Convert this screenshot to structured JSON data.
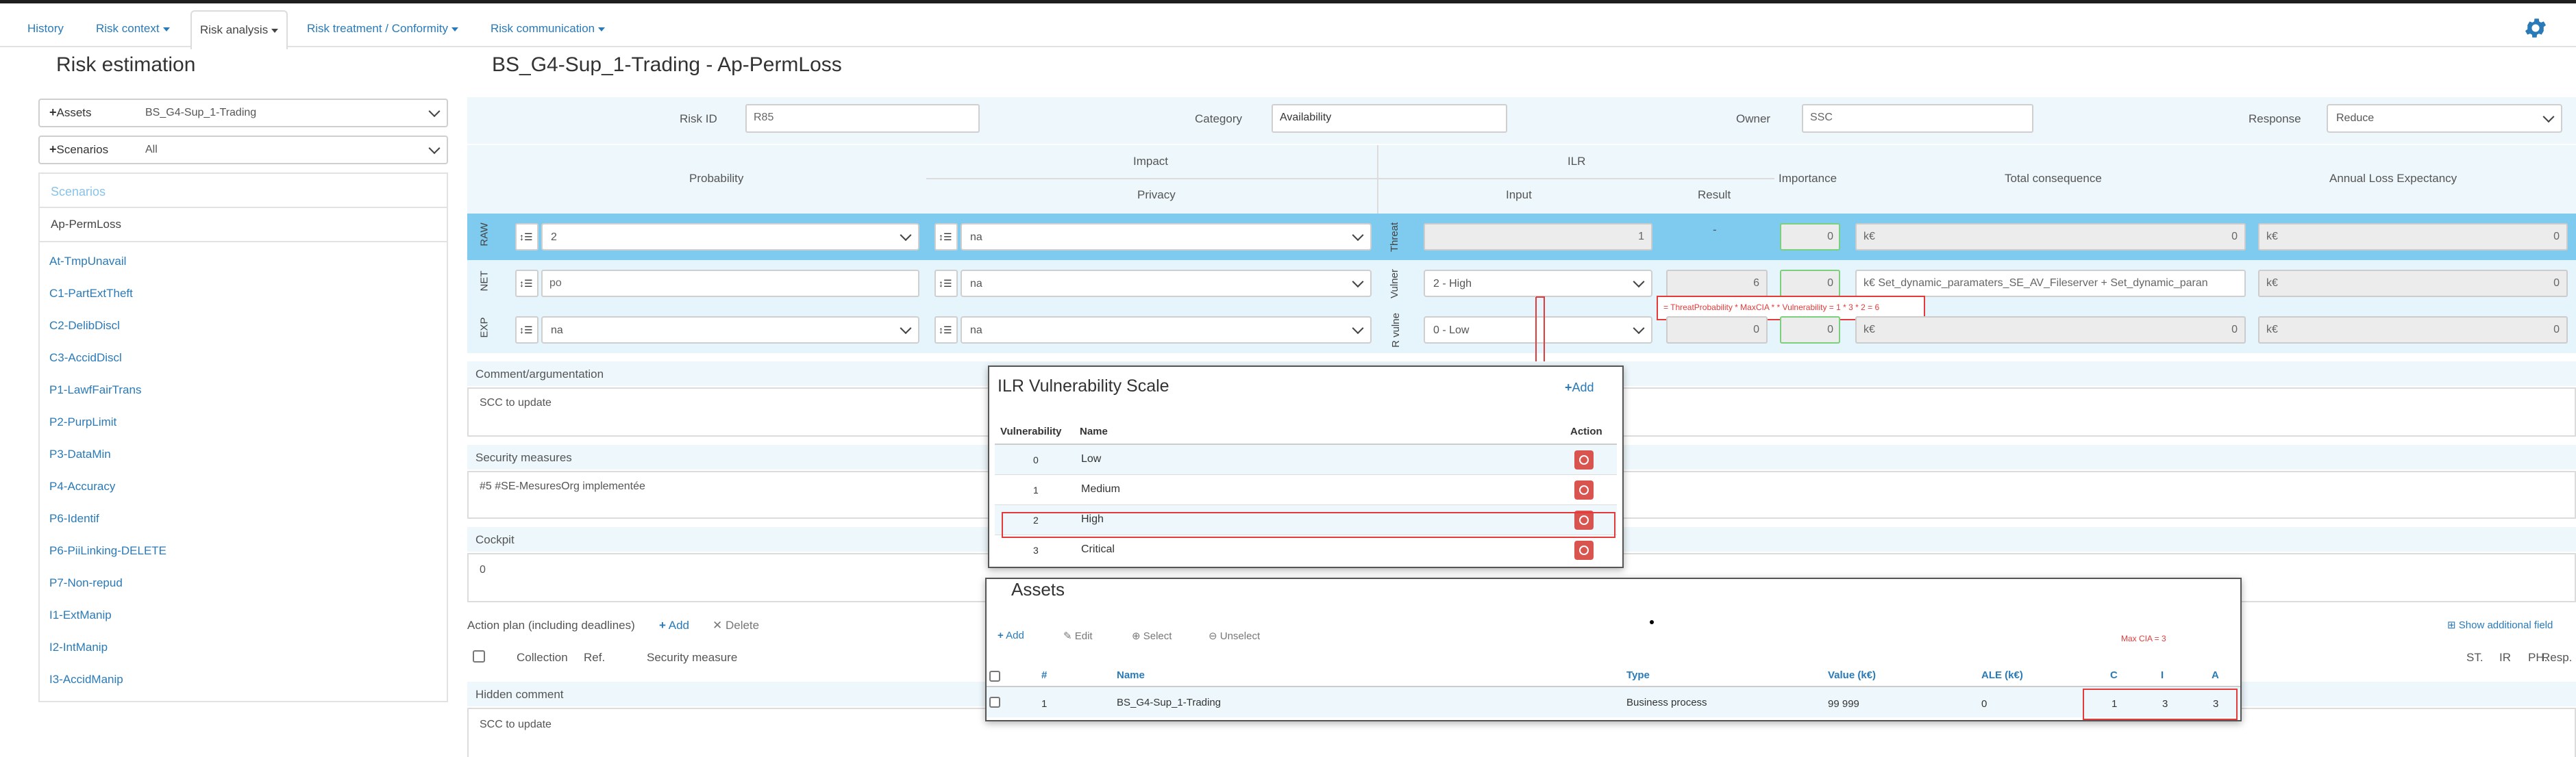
{
  "nav": {
    "tabs": [
      {
        "label": "History"
      },
      {
        "label": "Risk context"
      },
      {
        "label": "Risk analysis"
      },
      {
        "label": "Risk treatment / Conformity"
      },
      {
        "label": "Risk communication"
      }
    ]
  },
  "sidebar": {
    "title": "Risk estimation",
    "assets_label": "Assets",
    "assets_value": "BS_G4-Sup_1-Trading",
    "scenarios_label": "Scenarios",
    "scenarios_value": "All",
    "list_header": "Scenarios",
    "items": [
      "Ap-PermLoss",
      "At-TmpUnavail",
      "C1-PartExtTheft",
      "C2-DelibDiscl",
      "C3-AccidDiscl",
      "P1-LawfFairTrans",
      "P2-PurpLimit",
      "P3-DataMin",
      "P4-Accuracy",
      "P6-Identif",
      "P6-PiiLinking-DELETE",
      "P7-Non-repud",
      "I1-ExtManip",
      "I2-IntManip",
      "I3-AccidManip"
    ]
  },
  "main": {
    "title": "BS_G4-Sup_1-Trading - Ap-PermLoss",
    "risk_id_label": "Risk ID",
    "risk_id_value": "R85",
    "category_label": "Category",
    "category_value": "Availability",
    "owner_label": "Owner",
    "owner_value": "SSC",
    "response_label": "Response",
    "response_value": "Reduce",
    "headers": {
      "probability": "Probability",
      "impact": "Impact",
      "privacy": "Privacy",
      "ilr": "ILR",
      "input": "Input",
      "result": "Result",
      "importance": "Importance",
      "total": "Total consequence",
      "ale": "Annual Loss Expectancy"
    },
    "rows": [
      {
        "label": "RAW",
        "prob": "2",
        "privacy": "na",
        "ilr_side": "Threat",
        "ilr_input": "1",
        "result": "-",
        "importance": "0",
        "total_prefix": "k€",
        "total": "0",
        "ale_prefix": "k€",
        "ale": "0"
      },
      {
        "label": "NET",
        "prob": "po",
        "privacy": "na",
        "ilr_side": "Vulner",
        "ilr_input": "2 - High",
        "result": "6",
        "importance": "0",
        "total_prefix": "k€",
        "total": "Set_dynamic_paramaters_SE_AV_Fileserver + Set_dynamic_paran",
        "ale_prefix": "k€",
        "ale": "0"
      },
      {
        "label": "EXP",
        "prob": "na",
        "privacy": "na",
        "ilr_side": "R vulne",
        "ilr_input": "0 - Low",
        "result": "0",
        "importance": "0",
        "total_prefix": "k€",
        "total": "0",
        "ale_prefix": "k€",
        "ale": "0"
      }
    ],
    "formula_tooltip": "= ThreatProbability * MaxCIA * * Vulnerability = 1 * 3 * 2 = 6",
    "comment_label": "Comment/argumentation",
    "comment_value": "SCC to update",
    "measures_label": "Security measures",
    "measures_value": "#5 #SE-MesuresOrg implementée",
    "cockpit_label": "Cockpit",
    "cockpit_value": "0",
    "action_plan_label": "Action plan (including deadlines)",
    "add_label": "Add",
    "delete_label": "Delete",
    "plan_cols": [
      "Collection",
      "Ref.",
      "Security measure"
    ],
    "plan_cols_right": [
      "ST.",
      "IR",
      "PH.",
      "Resp."
    ],
    "show_additional": "Show additional field",
    "hidden_comment_label": "Hidden comment",
    "hidden_comment_value": "SCC to update"
  },
  "ilr_modal": {
    "title": "ILR Vulnerability Scale",
    "add_label": "Add",
    "col_vuln": "Vulnerability",
    "col_name": "Name",
    "col_action": "Action",
    "rows": [
      {
        "v": "0",
        "name": "Low"
      },
      {
        "v": "1",
        "name": "Medium"
      },
      {
        "v": "2",
        "name": "High"
      },
      {
        "v": "3",
        "name": "Critical"
      }
    ]
  },
  "assets_modal": {
    "title": "Assets",
    "add": "Add",
    "edit": "Edit",
    "select": "Select",
    "unselect": "Unselect",
    "max_cia": "Max CIA = 3",
    "cols": {
      "num": "#",
      "name": "Name",
      "type": "Type",
      "value": "Value (k€)",
      "ale": "ALE (k€)",
      "c": "C",
      "i": "I",
      "a": "A"
    },
    "row": {
      "num": "1",
      "name": "BS_G4-Sup_1-Trading",
      "type": "Business process",
      "value": "99 999",
      "ale": "0",
      "c": "1",
      "i": "3",
      "a": "3"
    }
  },
  "colors": {
    "accent": "#2a7ab8",
    "row_band": "#7ecbef",
    "danger": "#d9534f",
    "annotation": "#e43a3a"
  }
}
